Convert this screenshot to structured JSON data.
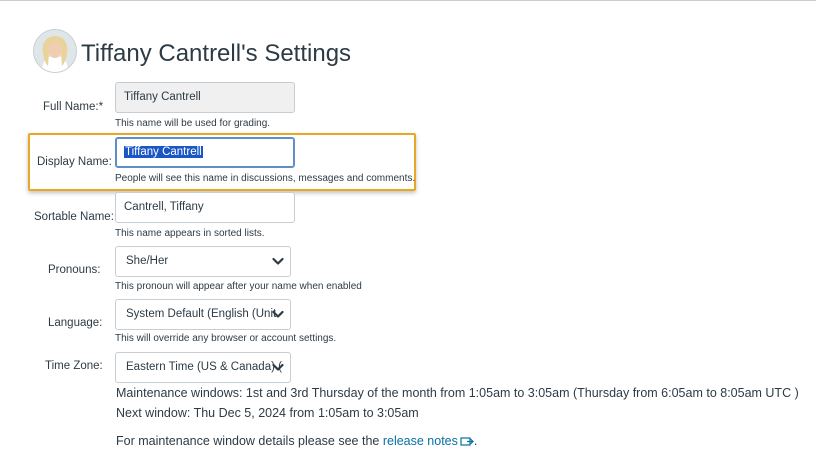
{
  "header": {
    "title": "Tiffany Cantrell's Settings"
  },
  "fields": {
    "full_name": {
      "label": "Full Name:*",
      "value": "Tiffany Cantrell",
      "hint": "This name will be used for grading."
    },
    "display_name": {
      "label": "Display Name:",
      "value": "Tiffany Cantrell",
      "hint": "People will see this name in discussions, messages and comments."
    },
    "sortable_name": {
      "label": "Sortable Name:",
      "value": "Cantrell, Tiffany",
      "hint": "This name appears in sorted lists."
    },
    "pronouns": {
      "label": "Pronouns:",
      "selected": "She/Her",
      "hint": "This pronoun will appear after your name when enabled"
    },
    "language": {
      "label": "Language:",
      "selected": "System Default (English (Unit",
      "hint": "This will override any browser or account settings."
    },
    "time_zone": {
      "label": "Time Zone:",
      "selected": "Eastern Time (US & Canada) ("
    }
  },
  "maintenance": {
    "windows": "Maintenance windows: 1st and 3rd Thursday of the month from 1:05am to 3:05am (Thursday from 6:05am to 8:05am UTC )",
    "next": "Next window: Thu Dec 5, 2024 from 1:05am to 3:05am",
    "details_prefix": "For maintenance window details please see the ",
    "details_link": "release notes",
    "details_suffix": "."
  },
  "colors": {
    "highlight_border": "#e8a823",
    "link": "#0770a3",
    "selection": "#1a56c4",
    "text": "#2d3b45"
  },
  "icons": {
    "avatar": "user-avatar",
    "select_arrow": "chevron-down-icon",
    "external_link": "external-link-icon"
  }
}
